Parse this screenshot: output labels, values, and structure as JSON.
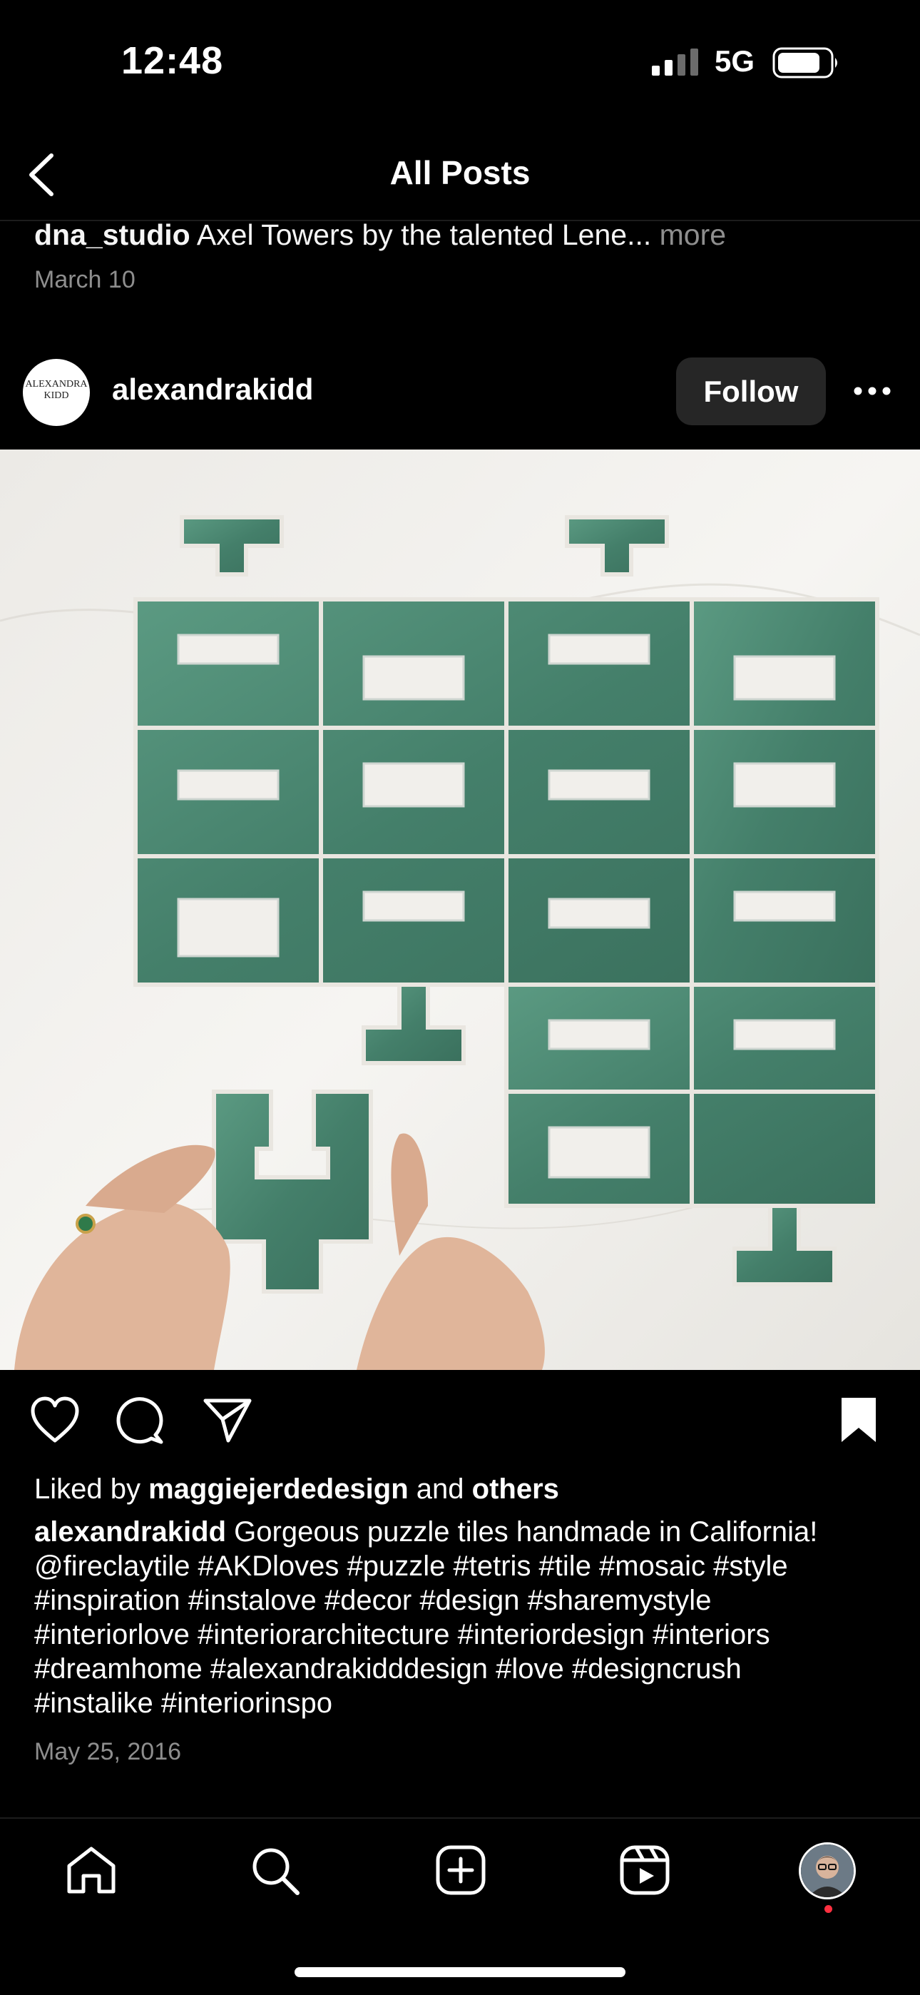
{
  "status_bar": {
    "time": "12:48",
    "network": "5G"
  },
  "header": {
    "title": "All Posts",
    "back_icon": "chevron-left-icon"
  },
  "previous_post": {
    "username": "dna_studio",
    "caption": "Axel Towers by the talented Lene...",
    "more_label": "more",
    "date": "March 10"
  },
  "post": {
    "avatar_text_line1": "ALEXANDRA",
    "avatar_text_line2": "KIDD",
    "username": "alexandrakidd",
    "follow_label": "Follow",
    "image_alt": "Green puzzle tiles on a white marble surface",
    "actions": {
      "like_icon": "heart-icon",
      "comment_icon": "comment-icon",
      "share_icon": "paper-plane-icon",
      "save_icon": "bookmark-icon"
    },
    "likes": {
      "prefix": "Liked by",
      "user": "maggiejerdedesign",
      "joiner": "and",
      "others": "others"
    },
    "caption": {
      "username": "alexandrakidd",
      "line1": "Gorgeous puzzle tiles handmade in California!",
      "line2": "@fireclaytile #AKDloves #puzzle #tetris #tile #mosaic #style",
      "line3": "#inspiration #instalove #decor #design #sharemystyle",
      "line4": "#interiorlove #interiorarchitecture #interiordesign #interiors",
      "line5": "#dreamhome #alexandrakidddesign #love #designcrush",
      "line6": "#instalike #interiorinspo"
    },
    "date": "May 25, 2016"
  },
  "tab_bar": {
    "items": [
      "home-icon",
      "search-icon",
      "add-post-icon",
      "reels-icon",
      "profile-avatar"
    ],
    "notification_color": "#ff3040"
  },
  "colors": {
    "background": "#000000",
    "follow_button": "#262626",
    "tile_green": "#4a8a72",
    "secondary_text": "#8e8e8e"
  }
}
